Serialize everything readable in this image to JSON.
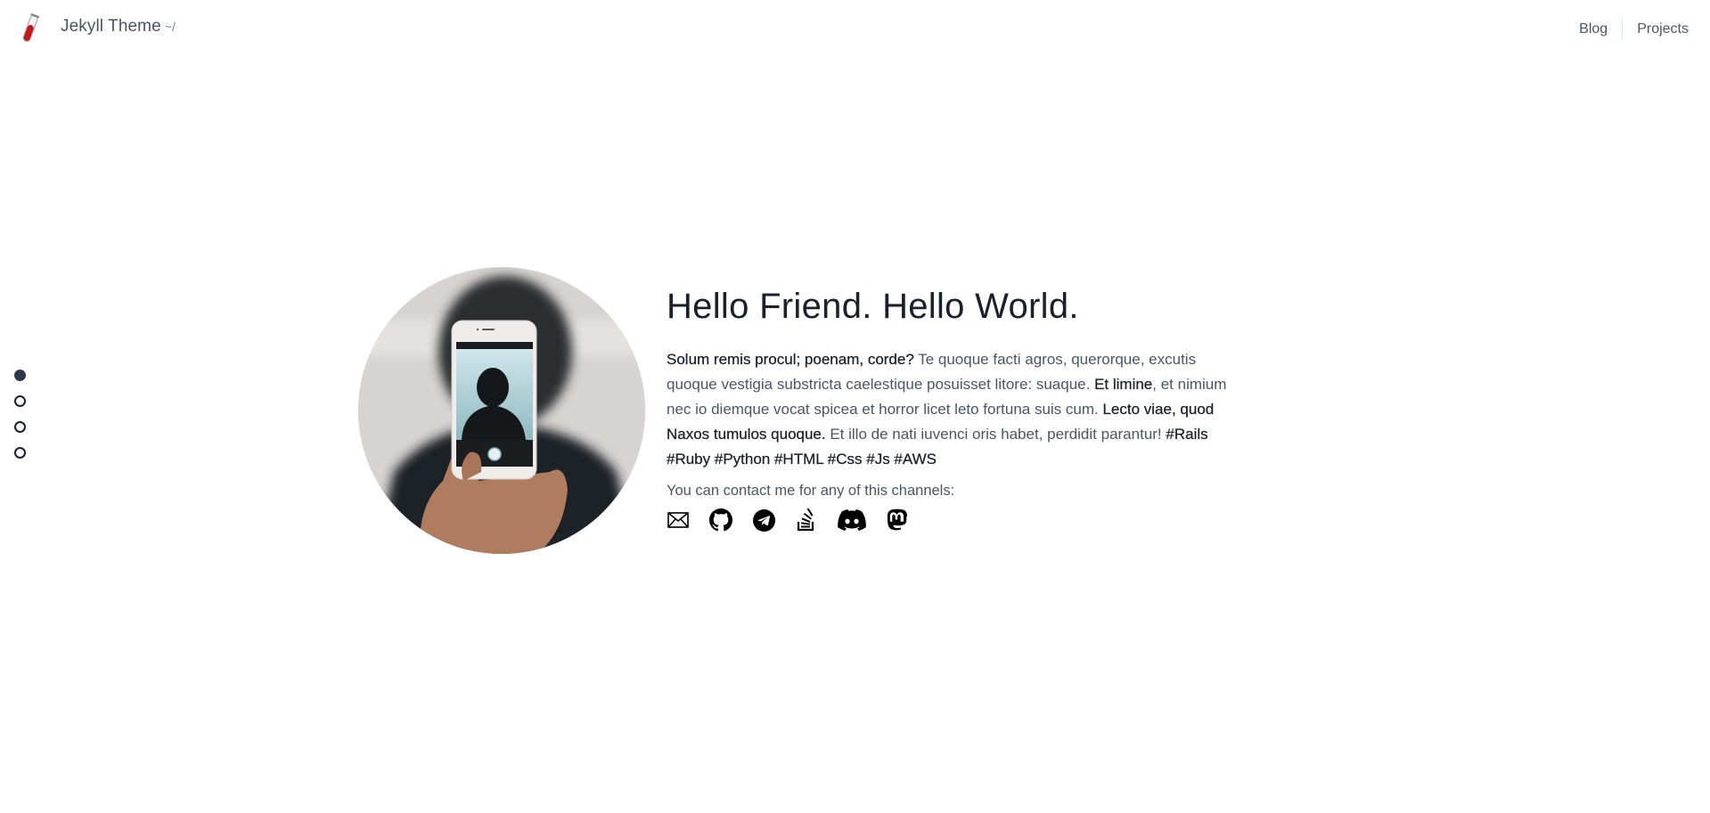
{
  "header": {
    "logo_icon": "test-tube-icon",
    "site_title": "Jekyll Theme",
    "site_suffix": "~/",
    "nav": [
      {
        "label": "Blog"
      },
      {
        "label": "Projects"
      }
    ]
  },
  "section_nav": {
    "dots": [
      {
        "active": true
      },
      {
        "active": false
      },
      {
        "active": false
      },
      {
        "active": false
      }
    ]
  },
  "hero": {
    "avatar_alt": "Person holding phone taking a photo",
    "title": "Hello Friend. Hello World.",
    "bio": [
      {
        "text": "Solum remis procul; poenam, corde?",
        "bold": true
      },
      {
        "text": " Te quoque facti agros, querorque, excutis quoque vestigia substricta caelestique posuisset litore: suaque. ",
        "bold": false
      },
      {
        "text": "Et limine",
        "bold": true
      },
      {
        "text": ", et nimium nec io diemque vocat spicea et horror licet leto fortuna suis cum. ",
        "bold": false
      },
      {
        "text": "Lecto viae, quod Naxos tumulos quoque.",
        "bold": true
      },
      {
        "text": " Et illo de nati iuvenci oris habet, perdidit parantur! ",
        "bold": false
      },
      {
        "text": "#Rails #Ruby #Python #HTML #Css #Js #AWS",
        "bold": true
      }
    ],
    "contact_text": "You can contact me for any of this channels:",
    "channels": [
      {
        "name": "email",
        "icon": "envelope-icon"
      },
      {
        "name": "github",
        "icon": "github-icon"
      },
      {
        "name": "telegram",
        "icon": "telegram-icon"
      },
      {
        "name": "stackoverflow",
        "icon": "stackoverflow-icon"
      },
      {
        "name": "discord",
        "icon": "discord-icon"
      },
      {
        "name": "mastodon",
        "icon": "mastodon-icon"
      }
    ]
  }
}
